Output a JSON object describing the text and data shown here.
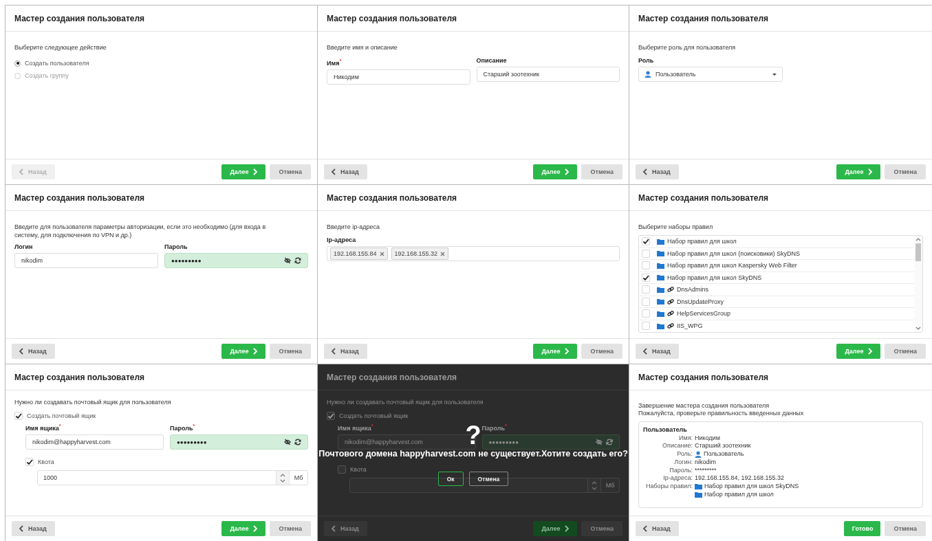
{
  "panels": [
    {
      "kind": "choice",
      "title": "Мастер создания пользователя",
      "prompt": "Выберите следующее действие",
      "options": [
        {
          "label": "Создать пользователя",
          "selected": true
        },
        {
          "label": "Создать группу",
          "selected": false
        }
      ],
      "footer": {
        "back": {
          "label": "Назад",
          "disabled": true
        },
        "next": {
          "label": "Далее"
        },
        "cancel": {
          "label": "Отмена"
        }
      }
    },
    {
      "kind": "name",
      "title": "Мастер создания пользователя",
      "prompt": "Введите имя и описание",
      "fields": [
        {
          "label": "Имя$^{*}$",
          "value": "Никодим",
          "kind": "text"
        },
        {
          "label": "Описание",
          "value": "Старший зоотехник",
          "kind": "text"
        }
      ],
      "footer": {
        "back": {
          "label": "Назад",
          "disabled": false
        },
        "next": {
          "label": "Далее"
        },
        "cancel": {
          "label": "Отмена"
        }
      }
    },
    {
      "kind": "role",
      "title": "Мастер создания пользователя",
      "prompt": "Выберите роль для пользователя",
      "label": "Роль",
      "value": "Пользователь",
      "footer": {
        "back": {
          "label": "Назад",
          "disabled": false
        },
        "next": {
          "label": "Далее"
        },
        "cancel": {
          "label": "Отмена"
        }
      }
    },
    {
      "kind": "auth",
      "title": "Мастер создания пользователя",
      "prompt": "Введите для пользователя параметры авторизации, если это необходимо (для входа в систему, для подключения по VPN и др.)",
      "fields": [
        {
          "label": "Логин",
          "value": "nikodim",
          "kind": "text"
        },
        {
          "label": "Пароль",
          "value": "●●●●●●●●●",
          "kind": "password"
        }
      ],
      "footer": {
        "back": {
          "label": "Назад",
          "disabled": false
        },
        "next": {
          "label": "Далее"
        },
        "cancel": {
          "label": "Отмена"
        }
      }
    },
    {
      "kind": "ip",
      "title": "Мастер создания пользователя",
      "prompt": "Введите ip-адреса",
      "label": "Ip-адреса",
      "tags": [
        "192.168.155.84",
        "192.168.155.32"
      ],
      "footer": {
        "back": {
          "label": "Назад",
          "disabled": false
        },
        "next": {
          "label": "Далее"
        },
        "cancel": {
          "label": "Отмена"
        }
      }
    },
    {
      "kind": "rules",
      "title": "Мастер создания пользователя",
      "prompt": "Выберите наборы правил",
      "items": [
        {
          "label": "Набор правил для школ",
          "checked": true,
          "linked": false
        },
        {
          "label": "Набор правил для школ (поисковики) SkyDNS",
          "checked": false,
          "linked": false
        },
        {
          "label": "Набор правил для школ Kaspersky Web Filter",
          "checked": false,
          "linked": false
        },
        {
          "label": "Набор правил для школ SkyDNS",
          "checked": true,
          "linked": false
        },
        {
          "label": "DnsAdmins",
          "checked": false,
          "linked": true
        },
        {
          "label": "DnsUpdateProxy",
          "checked": false,
          "linked": true
        },
        {
          "label": "HelpServicesGroup",
          "checked": false,
          "linked": true
        },
        {
          "label": "IIS_WPG",
          "checked": false,
          "linked": true
        }
      ],
      "footer": {
        "back": {
          "label": "Назад",
          "disabled": false
        },
        "next": {
          "label": "Далее"
        },
        "cancel": {
          "label": "Отмена"
        }
      }
    },
    {
      "kind": "mailbox",
      "title": "Мастер создания пользователя",
      "prompt": "Нужно ли создавать почтовый ящик для пользователя",
      "create": {
        "label": "Создать почтовый ящик",
        "checked": true
      },
      "fields": [
        {
          "label": "Имя ящика$^{*}$",
          "value": "nikodim@happyharvest.com",
          "kind": "text"
        },
        {
          "label": "Пароль$^{*}$",
          "value": "●●●●●●●●●",
          "kind": "password"
        }
      ],
      "quota": {
        "label": "Квота",
        "checked": true,
        "value": "1000",
        "unit": "Мб"
      },
      "footer": {
        "back": {
          "label": "Назад",
          "disabled": false
        },
        "next": {
          "label": "Далее"
        },
        "cancel": {
          "label": "Отмена"
        }
      }
    },
    {
      "kind": "mailbox",
      "title": "Мастер создания пользователя",
      "prompt": "Нужно ли создавать почтовый ящик для пользователя",
      "create": {
        "label": "Создать почтовый ящик",
        "checked": true
      },
      "fields": [
        {
          "label": "Имя ящика$^{*}$",
          "value": "nikodim@happyharvest.com",
          "kind": "text"
        },
        {
          "label": "Пароль$^{*}$",
          "value": "●●●●●●●●●",
          "kind": "password"
        }
      ],
      "quota": {
        "label": "Квота",
        "checked": false,
        "unit": "Мб"
      },
      "footer": {
        "back": {
          "label": "Назад",
          "disabled": false
        },
        "next": {
          "label": "Далее"
        },
        "cancel": {
          "label": "Отмена"
        }
      },
      "dialog": {
        "symbol": "?",
        "message": "Почтового домена happyharvest.com не существует.Хотите создать его?",
        "buttons": [
          {
            "label": "Ок",
            "kind": "confirm"
          },
          {
            "label": "Отмена",
            "kind": "cancel"
          }
        ]
      }
    },
    {
      "kind": "summary",
      "title": "Мастер создания пользователя",
      "lines": [
        "Завершение мастера создания пользователя",
        "Пожалуйста, проверьте правильность введенных данных"
      ],
      "section": "Пользователь",
      "rows": [
        {
          "label": "Имя:",
          "values": [
            {
              "text": "Никодим",
              "kind": "text"
            }
          ]
        },
        {
          "label": "Описание:",
          "values": [
            {
              "text": "Старший зоотехник",
              "kind": "text"
            }
          ]
        },
        {
          "label": "Роль:",
          "values": [
            {
              "text": "Пользователь",
              "kind": "user"
            }
          ]
        },
        {
          "label": "Логин:",
          "values": [
            {
              "text": "nikodim",
              "kind": "text"
            }
          ]
        },
        {
          "label": "Пароль:",
          "values": [
            {
              "text": "*********",
              "kind": "text"
            }
          ]
        },
        {
          "label": "Ip-адреса:",
          "values": [
            {
              "text": "192.168.155.84, 192.168.155.32",
              "kind": "text"
            }
          ]
        },
        {
          "label": "Наборы правил:",
          "values": [
            {
              "text": "Набор правил для школ SkyDNS",
              "kind": "folder"
            },
            {
              "text": "Набор правил для школ",
              "kind": "folder"
            }
          ]
        }
      ],
      "footer": {
        "back": {
          "label": "Назад",
          "disabled": false
        },
        "next": {
          "label": "Готово"
        },
        "cancel": {
          "label": "Отмена"
        }
      }
    }
  ]
}
